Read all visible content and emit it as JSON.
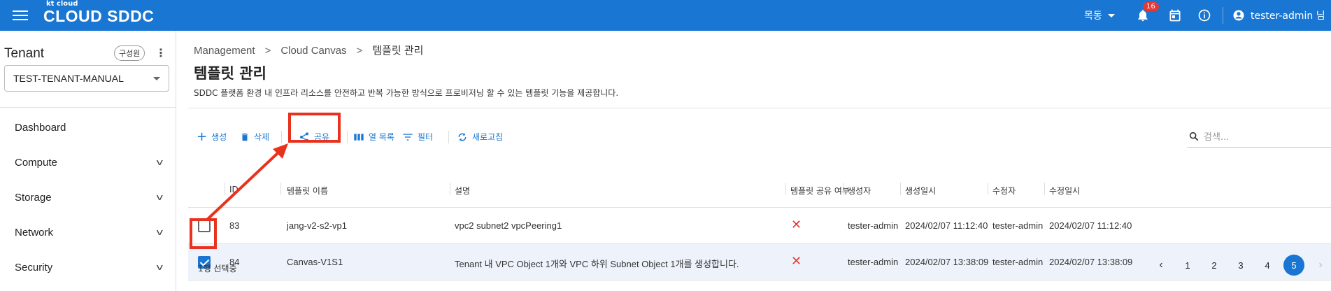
{
  "header": {
    "brand_small": "kt cloud",
    "brand": "CLOUD SDDC",
    "region": "목동",
    "notifications_count": "16",
    "user": "tester-admin 님"
  },
  "sidebar": {
    "tenant_label": "Tenant",
    "member_chip": "구성원",
    "tenant_value": "TEST-TENANT-MANUAL",
    "items": [
      {
        "label": "Dashboard",
        "has_children": false
      },
      {
        "label": "Compute",
        "has_children": true
      },
      {
        "label": "Storage",
        "has_children": true
      },
      {
        "label": "Network",
        "has_children": true
      },
      {
        "label": "Security",
        "has_children": true
      }
    ]
  },
  "breadcrumb": [
    "Management",
    "Cloud Canvas",
    "템플릿 관리"
  ],
  "page": {
    "title": "템플릿 관리",
    "description": "SDDC 플랫폼 환경 내 인프라 리소스를 안전하고 반복 가능한 방식으로 프로비저닝 할 수 있는 템플릿 기능을 제공합니다."
  },
  "toolbar": {
    "create": "생성",
    "delete": "삭제",
    "share": "공유",
    "columns": "열 목록",
    "filter": "필터",
    "refresh": "새로고침",
    "search_placeholder": "검색..."
  },
  "table": {
    "columns": [
      "ID",
      "템플릿 이름",
      "설명",
      "템플릿 공유 여부",
      "생성자",
      "생성일시",
      "수정자",
      "수정일시"
    ],
    "rows": [
      {
        "checked": false,
        "id": "83",
        "name": "jang-v2-s2-vp1",
        "desc": "vpc2 subnet2 vpcPeering1",
        "shared": "✕",
        "creator": "tester-admin",
        "created": "2024/02/07 11:12:40",
        "modifier": "tester-admin",
        "modified": "2024/02/07 11:12:40"
      },
      {
        "checked": true,
        "id": "84",
        "name": "Canvas-V1S1",
        "desc": "Tenant 내 VPC Object 1개와 VPC 하위 Subnet Object 1개를 생성합니다.",
        "shared": "✕",
        "creator": "tester-admin",
        "created": "2024/02/07 13:38:09",
        "modifier": "tester-admin",
        "modified": "2024/02/07 13:38:09"
      }
    ]
  },
  "footer": {
    "selection": "1행 선택중",
    "pages": [
      "1",
      "2",
      "3",
      "4",
      "5"
    ],
    "current_page": "5"
  },
  "colors": {
    "primary": "#1976d2",
    "highlight": "#e8321e",
    "error_x": "#e53935"
  }
}
